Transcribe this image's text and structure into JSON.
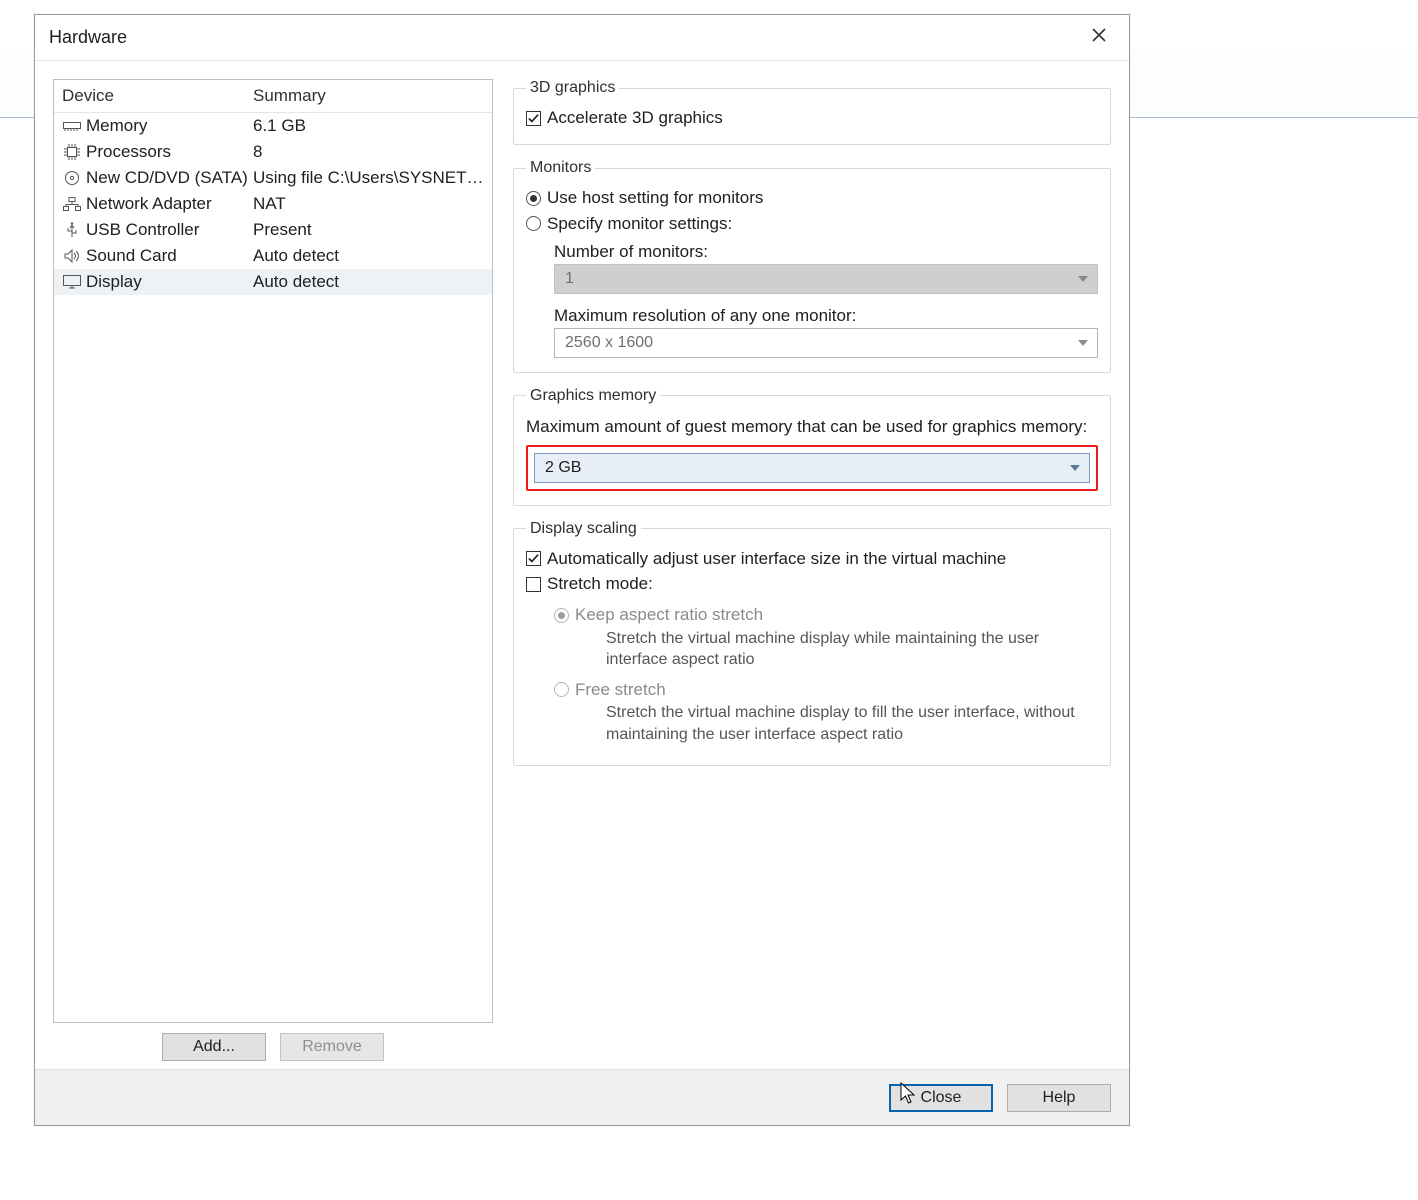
{
  "dialog": {
    "title": "Hardware",
    "close_label": "Close window"
  },
  "device_table": {
    "headers": {
      "device": "Device",
      "summary": "Summary"
    },
    "rows": [
      {
        "name": "Memory",
        "summary": "6.1 GB",
        "icon": "memory-icon",
        "selected": false
      },
      {
        "name": "Processors",
        "summary": "8",
        "icon": "cpu-icon",
        "selected": false
      },
      {
        "name": "New CD/DVD (SATA)",
        "summary": "Using file C:\\Users\\SYSNETT...",
        "icon": "disc-icon",
        "selected": false
      },
      {
        "name": "Network Adapter",
        "summary": "NAT",
        "icon": "network-icon",
        "selected": false
      },
      {
        "name": "USB Controller",
        "summary": "Present",
        "icon": "usb-icon",
        "selected": false
      },
      {
        "name": "Sound Card",
        "summary": "Auto detect",
        "icon": "sound-icon",
        "selected": false
      },
      {
        "name": "Display",
        "summary": "Auto detect",
        "icon": "display-icon",
        "selected": true
      }
    ],
    "add_label": "Add...",
    "remove_label": "Remove"
  },
  "graphics3d": {
    "legend": "3D graphics",
    "accelerate_label": "Accelerate 3D graphics",
    "accelerate_checked": true
  },
  "monitors": {
    "legend": "Monitors",
    "use_host_label": "Use host setting for monitors",
    "specify_label": "Specify monitor settings:",
    "selected": "use_host",
    "num_label": "Number of monitors:",
    "num_value": "1",
    "maxres_label": "Maximum resolution of any one monitor:",
    "maxres_value": "2560 x 1600"
  },
  "graphics_memory": {
    "legend": "Graphics memory",
    "prompt": "Maximum amount of guest memory that can be used for graphics memory:",
    "value": "2 GB"
  },
  "display_scaling": {
    "legend": "Display scaling",
    "auto_adjust_label": "Automatically adjust user interface size in the virtual machine",
    "auto_adjust_checked": true,
    "stretch_mode_label": "Stretch mode:",
    "stretch_mode_checked": false,
    "keep_aspect_label": "Keep aspect ratio stretch",
    "keep_aspect_desc": "Stretch the virtual machine display while maintaining the user interface aspect ratio",
    "free_stretch_label": "Free stretch",
    "free_stretch_desc": "Stretch the virtual machine display to fill the user interface, without maintaining the user interface aspect ratio",
    "stretch_selected": "keep_aspect"
  },
  "footer": {
    "close": "Close",
    "help": "Help"
  }
}
